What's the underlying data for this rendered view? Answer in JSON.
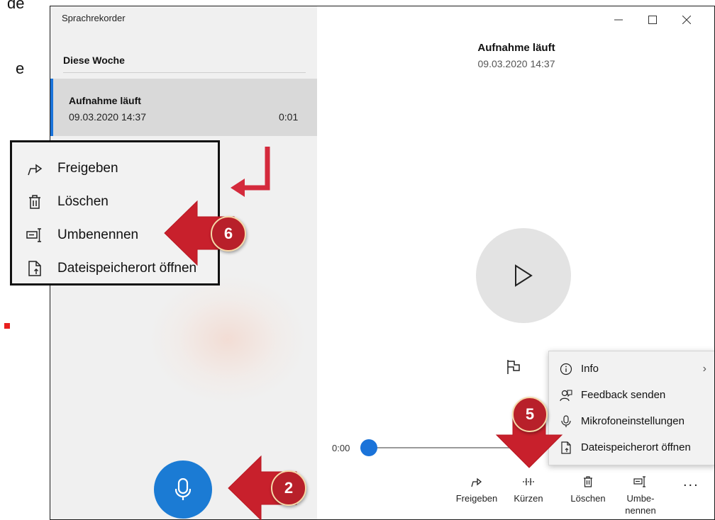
{
  "page_fragments": {
    "top": "de",
    "middle": "e"
  },
  "app": {
    "title": "Sprachrekorder"
  },
  "window_controls": {
    "minimize": "—",
    "maximize": "☐",
    "close": "✕"
  },
  "sidebar": {
    "section_heading": "Diese Woche",
    "recordings": [
      {
        "title": "Aufnahme läuft",
        "date": "09.03.2020 14:37",
        "duration": "0:01"
      }
    ]
  },
  "main": {
    "title": "Aufnahme läuft",
    "date": "09.03.2020 14:37",
    "playback_position": "0:00"
  },
  "commands": {
    "share": "Freigeben",
    "trim": "Kürzen",
    "delete": "Löschen",
    "rename": "Umbe-\nnennen",
    "more": "..."
  },
  "more_menu": {
    "items": [
      "Info",
      "Feedback senden",
      "Mikrofoneinstellungen",
      "Dateispeicherort öffnen"
    ]
  },
  "context_menu": {
    "items": [
      "Freigeben",
      "Löschen",
      "Umbenennen",
      "Dateispeicherort öffnen"
    ]
  },
  "callouts": {
    "record": "2",
    "more_menu": "5",
    "rename": "6"
  },
  "colors": {
    "accent": "#1a73d9",
    "callout": "#b8202a",
    "arrow": "#d42a3c"
  }
}
